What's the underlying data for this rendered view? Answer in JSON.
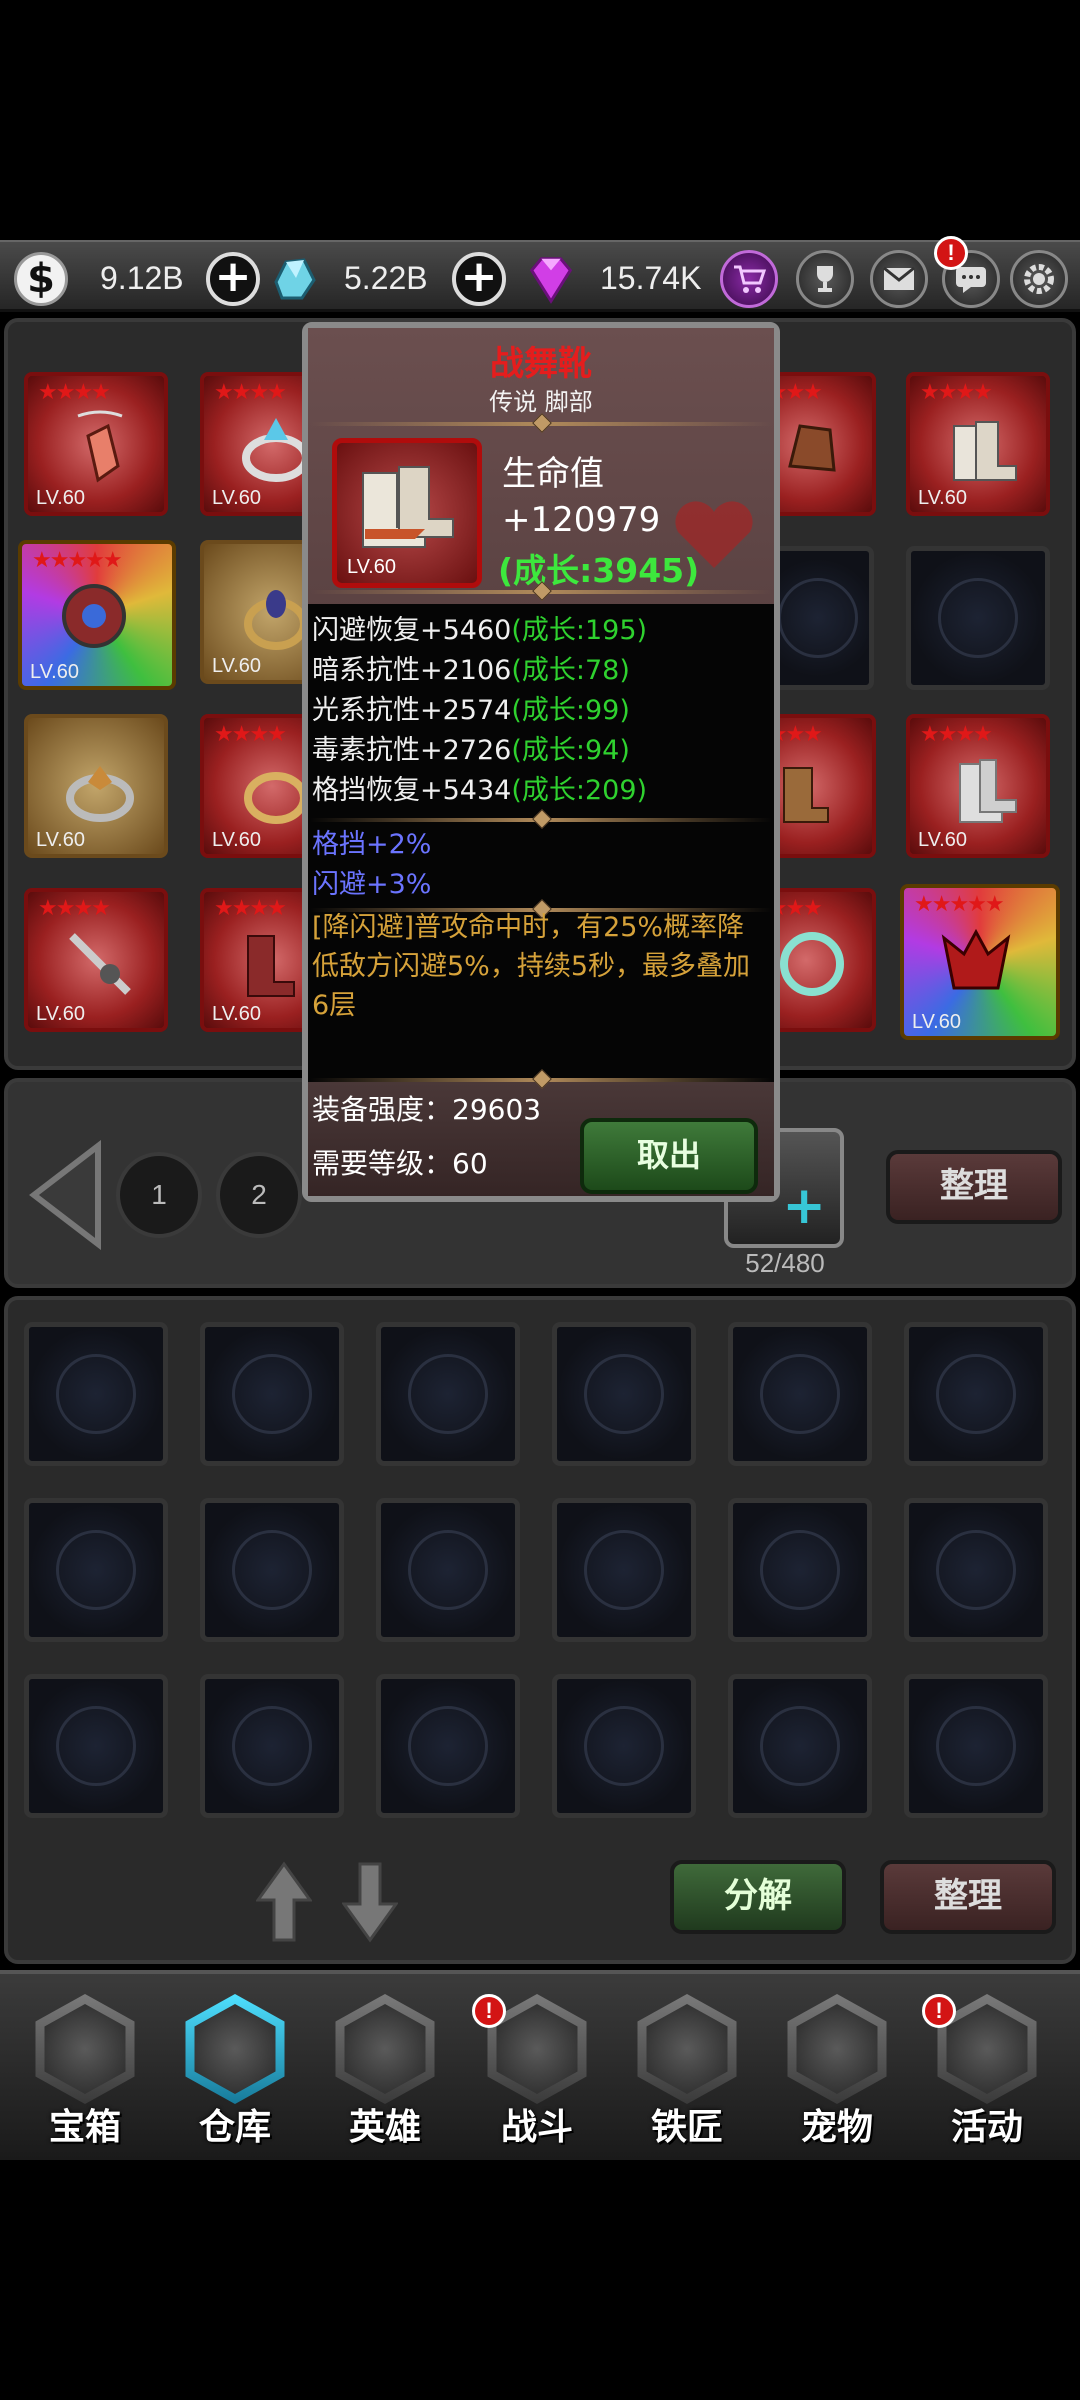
{
  "currency": {
    "gold": "9.12B",
    "crystal": "5.22B",
    "gem": "15.74K"
  },
  "top_buttons": [
    "shop",
    "trophy",
    "mail",
    "chat",
    "settings"
  ],
  "alert_mark": "!",
  "grid_items": {
    "level_label": "LV.60"
  },
  "pager": {
    "pages": [
      "1",
      "2"
    ],
    "capacity": "52/480",
    "sort_label": "整理"
  },
  "storage_actions": {
    "decompose_label": "分解",
    "sort_label": "整理"
  },
  "popup": {
    "name": "战舞靴",
    "quality_slot": "传说  脚部",
    "item_level": "LV.60",
    "main_stat_name": "生命值",
    "main_stat_value": "+120979",
    "main_stat_growth": "(成长:3945)",
    "stats": [
      {
        "name": "闪避恢复+5460",
        "growth": "(成长:195)"
      },
      {
        "name": "暗系抗性+2106",
        "growth": "(成长:78)"
      },
      {
        "name": "光系抗性+2574",
        "growth": "(成长:99)"
      },
      {
        "name": "毒素抗性+2726",
        "growth": "(成长:94)"
      },
      {
        "name": "格挡恢复+5434",
        "growth": "(成长:209)"
      }
    ],
    "bonus_stats": [
      "格挡+2%",
      "闪避+3%"
    ],
    "skill_text": "[降闪避]普攻命中时，有25%概率降低敌方闪避5%，持续5秒，最多叠加6层",
    "power_label": "装备强度：29603",
    "required_level_label": "需要等级：60",
    "take_out_label": "取出"
  },
  "nav": [
    {
      "label": "宝箱",
      "icon": "chest-icon"
    },
    {
      "label": "仓库",
      "icon": "backpack-icon"
    },
    {
      "label": "英雄",
      "icon": "hero-icon"
    },
    {
      "label": "战斗",
      "icon": "battle-icon"
    },
    {
      "label": "铁匠",
      "icon": "blacksmith-icon"
    },
    {
      "label": "宠物",
      "icon": "pet-icon"
    },
    {
      "label": "活动",
      "icon": "event-icon"
    }
  ],
  "colors": {
    "popup_title": "#e51d1d",
    "growth": "#2fd22f",
    "bonus": "#6b74ff",
    "skill": "#d6a23a",
    "active_tab": "#4fe0ff"
  }
}
